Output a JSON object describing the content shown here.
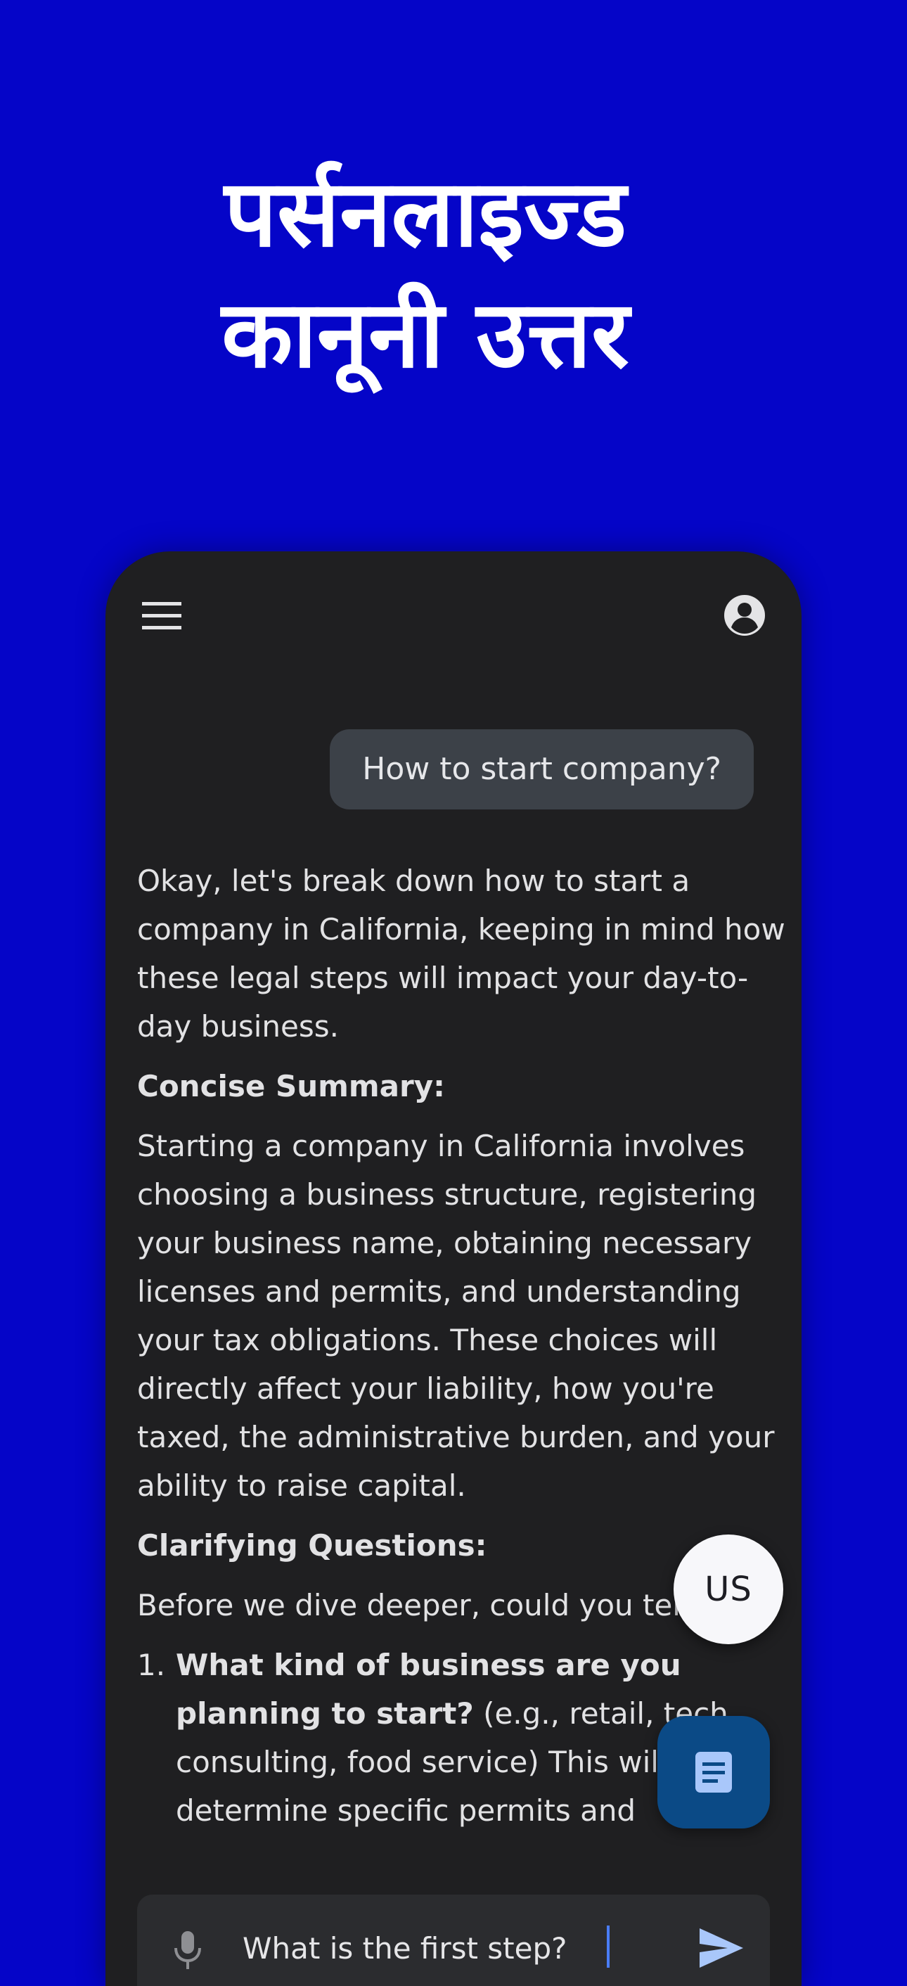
{
  "headline": {
    "line1": "पर्सनलाइज्ड",
    "line2": "कानूनी उत्तर"
  },
  "toolbar": {
    "menu_icon": "menu-icon",
    "account_icon": "account-circle-icon"
  },
  "chat": {
    "user_message": "How to start company?",
    "answer": {
      "intro": "Okay, let's break down how to start a company in California, keeping in mind how these legal steps will impact your day-to-day business.",
      "summary_heading": "Concise Summary:",
      "summary_text": "Starting a company in California involves choosing a business structure, registering your business name, obtaining necessary licenses and permits, and understanding your tax obligations. These choices will directly affect your liability, how you're taxed, the administrative burden, and your ability to raise capital.",
      "questions_heading": "Clarifying Questions:",
      "questions_intro": "Before we dive deeper, could you tell me:",
      "questions": [
        {
          "number": "1.",
          "bold": "What kind of business are you planning to start?",
          "text": " (e.g., retail, tech, consulting, food service) This will help determine specific permits and"
        }
      ]
    }
  },
  "floating": {
    "jurisdiction_label": "US",
    "notes_icon": "notes-icon"
  },
  "composer": {
    "mic_icon": "mic-icon",
    "value": "What is the first step?",
    "send_icon": "send-icon"
  },
  "colors": {
    "background": "#0505c8",
    "phone": "#1f1f21",
    "user_bubble": "#3c4148",
    "notes_fab": "#0b4a86",
    "send": "#a9c7fa"
  }
}
